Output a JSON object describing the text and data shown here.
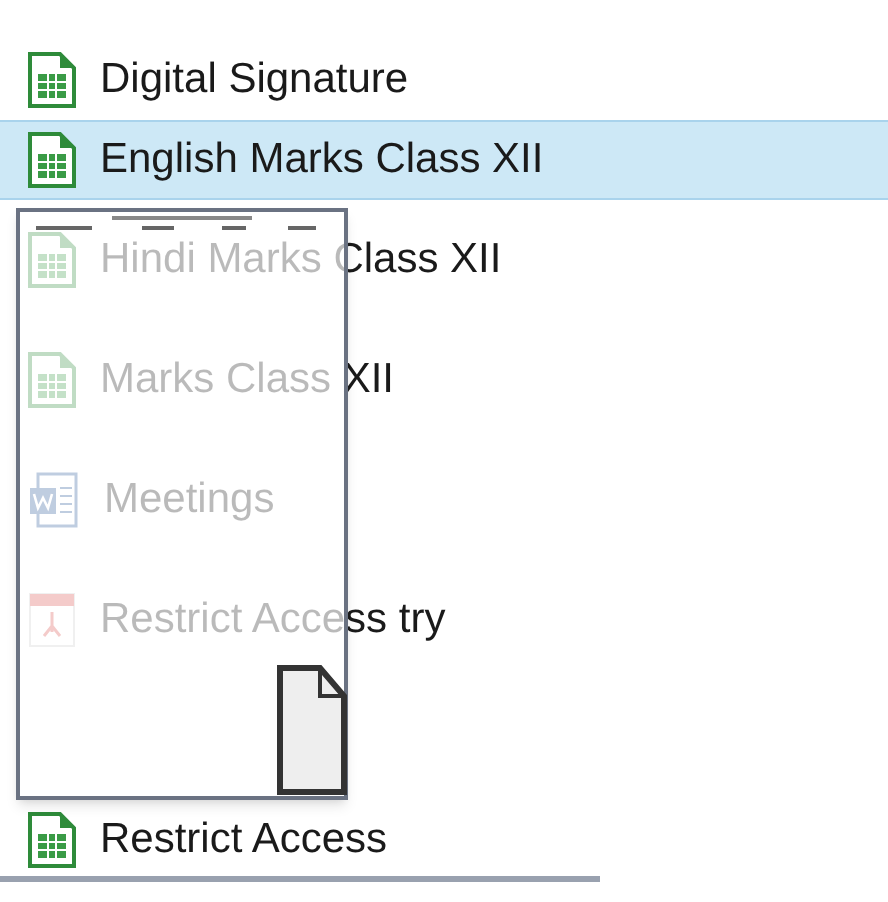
{
  "files": [
    {
      "name": "Digital Signature",
      "kind": "spreadsheet",
      "selected": false
    },
    {
      "name": "English Marks Class XII",
      "kind": "spreadsheet",
      "selected": true
    },
    {
      "name": "Hindi Marks Class XII",
      "kind": "spreadsheet",
      "selected": false
    },
    {
      "name": "Marks Class XII",
      "kind": "spreadsheet",
      "selected": false
    },
    {
      "name": "Meetings",
      "kind": "document",
      "selected": false
    },
    {
      "name": "Restrict Access try",
      "kind": "pdf",
      "selected": false
    },
    {
      "name": "Restrict Access",
      "kind": "spreadsheet",
      "selected": false
    }
  ]
}
